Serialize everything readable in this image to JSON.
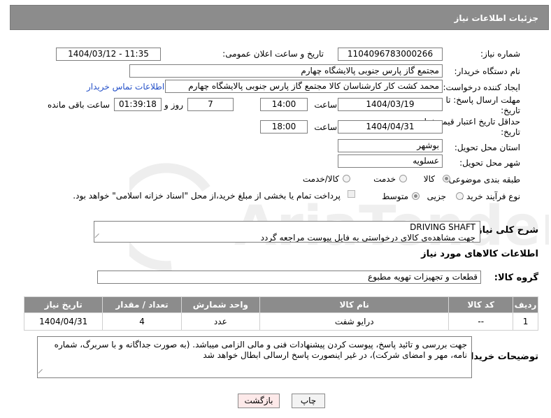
{
  "header": {
    "title": "جزئیات اطلاعات نیاز"
  },
  "fields": {
    "need_number_label": "شماره نیاز:",
    "need_number": "1104096783000266",
    "announce_label": "تاریخ و ساعت اعلان عمومی:",
    "announce_value": "1404/03/12 - 11:35",
    "buyer_org_label": "نام دستگاه خریدار:",
    "buyer_org": "مجتمع گاز پارس جنوبی  پالایشگاه چهارم",
    "creator_label": "ایجاد کننده درخواست:",
    "creator": "محمد کشت کار کارشناسان کالا مجتمع گاز پارس جنوبی  پالایشگاه چهارم",
    "contact_link": "اطلاعات تماس خریدار",
    "deadline_label": "مهلت ارسال پاسخ: تا تاریخ:",
    "deadline_date": "1404/03/19",
    "time_label": "ساعت",
    "deadline_time": "14:00",
    "days_value": "7",
    "days_label": "روز و",
    "remaining_time": "01:39:18",
    "remaining_label": "ساعت باقی مانده",
    "validity_label": "حداقل تاریخ اعتبار قیمت: تا تاریخ:",
    "validity_date": "1404/04/31",
    "validity_time": "18:00",
    "province_label": "استان محل تحویل:",
    "province": "بوشهر",
    "city_label": "شهر محل تحویل:",
    "city": "عسلویه",
    "category_label": "طبقه بندی موضوعی:",
    "category_options": [
      "کالا",
      "خدمت",
      "کالا/خدمت"
    ],
    "process_label": "نوع فرآیند خرید :",
    "process_options": [
      "جزیی",
      "متوسط"
    ],
    "payment_note": "پرداخت تمام یا بخشی از مبلغ خرید،از محل \"اسناد خزانه اسلامی\" خواهد بود."
  },
  "description": {
    "label": "شرح کلی نیاز:",
    "line1": "DRIVING SHAFT",
    "line2": "جهت مشاهده‌ی کالای درخواستی به فایل پیوست مراجعه گردد"
  },
  "goods_info": {
    "title": "اطلاعات کالاهای مورد نیاز",
    "group_label": "گروه کالا:",
    "group_value": "قطعات و تجهیزات تهویه مطبوع"
  },
  "table": {
    "headers": [
      "ردیف",
      "کد کالا",
      "نام کالا",
      "واحد شمارش",
      "تعداد / مقدار",
      "تاریخ نیاز"
    ],
    "rows": [
      {
        "row": "1",
        "code": "--",
        "name": "درایو شفت",
        "unit": "عدد",
        "qty": "4",
        "date": "1404/04/31"
      }
    ]
  },
  "buyer_notes": {
    "label": "توضیحات خریدار:",
    "text": "جهت بررسی و تائید پاسخ، پیوست کردن پیشنهادات فنی و مالی الزامی میباشد. (به صورت جداگانه و با سربرگ، شماره نامه، مهر و امضای شرکت)، در غیر اینصورت پاسخ ارسالی ابطال خواهد شد"
  },
  "buttons": {
    "print": "چاپ",
    "back": "بازگشت"
  },
  "colors": {
    "header_bg": "#8c8c8c",
    "link": "#2450c8",
    "back_button_bg": "#fde9e9"
  }
}
